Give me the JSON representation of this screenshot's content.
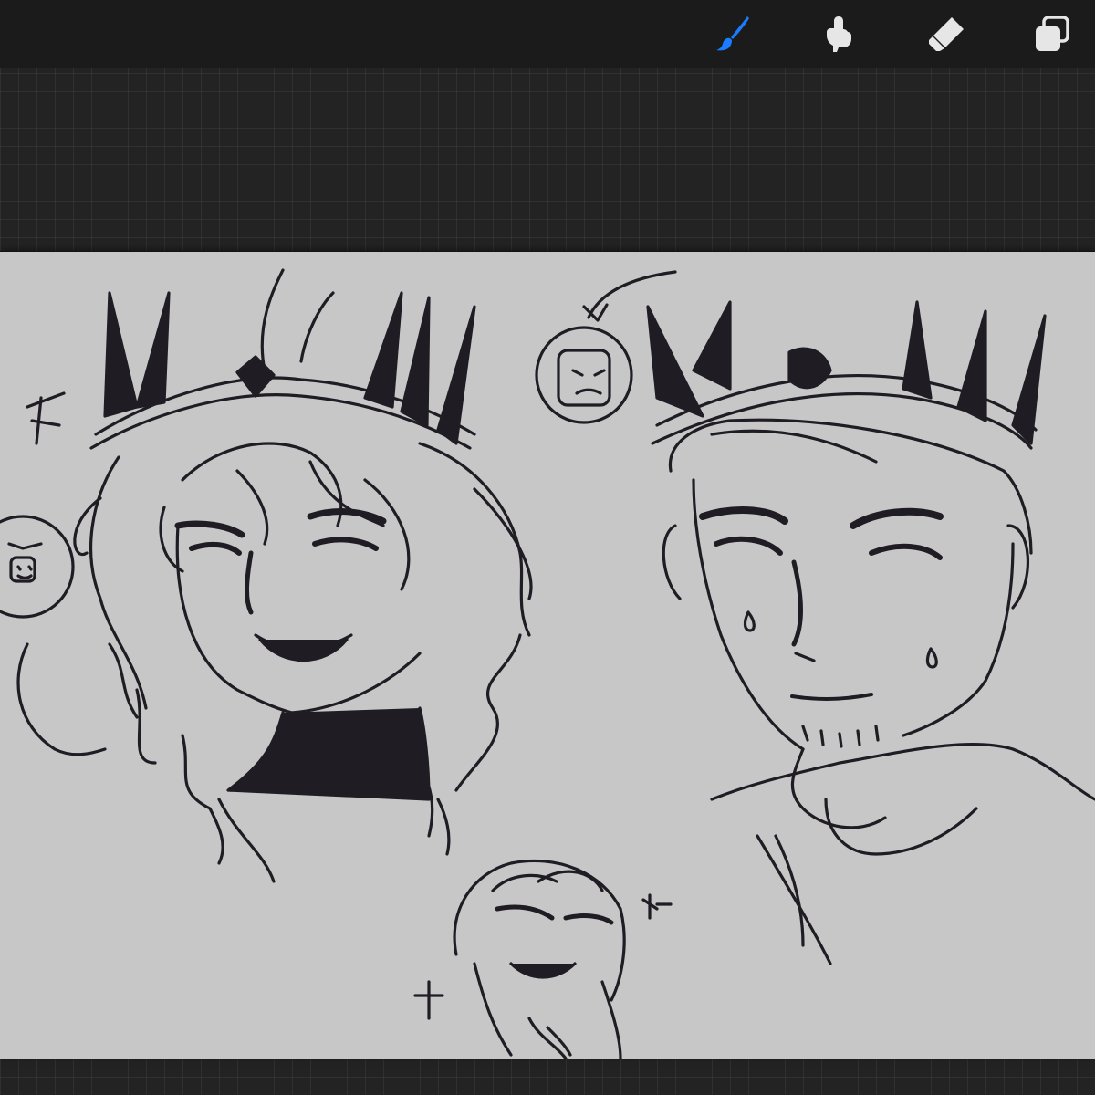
{
  "app": {
    "background_color": "#232323",
    "toolbar_color": "#1b1b1b",
    "canvas_color": "#c7c7c7",
    "ink_color": "#1f1c24"
  },
  "toolbar": {
    "tools": [
      {
        "id": "brush",
        "icon": "brush-icon",
        "active": true,
        "color": "#1a7cff"
      },
      {
        "id": "smudge",
        "icon": "smudge-icon",
        "active": false,
        "color": "#e6e6e6"
      },
      {
        "id": "eraser",
        "icon": "eraser-icon",
        "active": false,
        "color": "#e6e6e6"
      },
      {
        "id": "layers",
        "icon": "layers-icon",
        "active": false,
        "color": "#e6e6e6"
      }
    ]
  },
  "canvas": {
    "content": "sketch-drawing"
  }
}
